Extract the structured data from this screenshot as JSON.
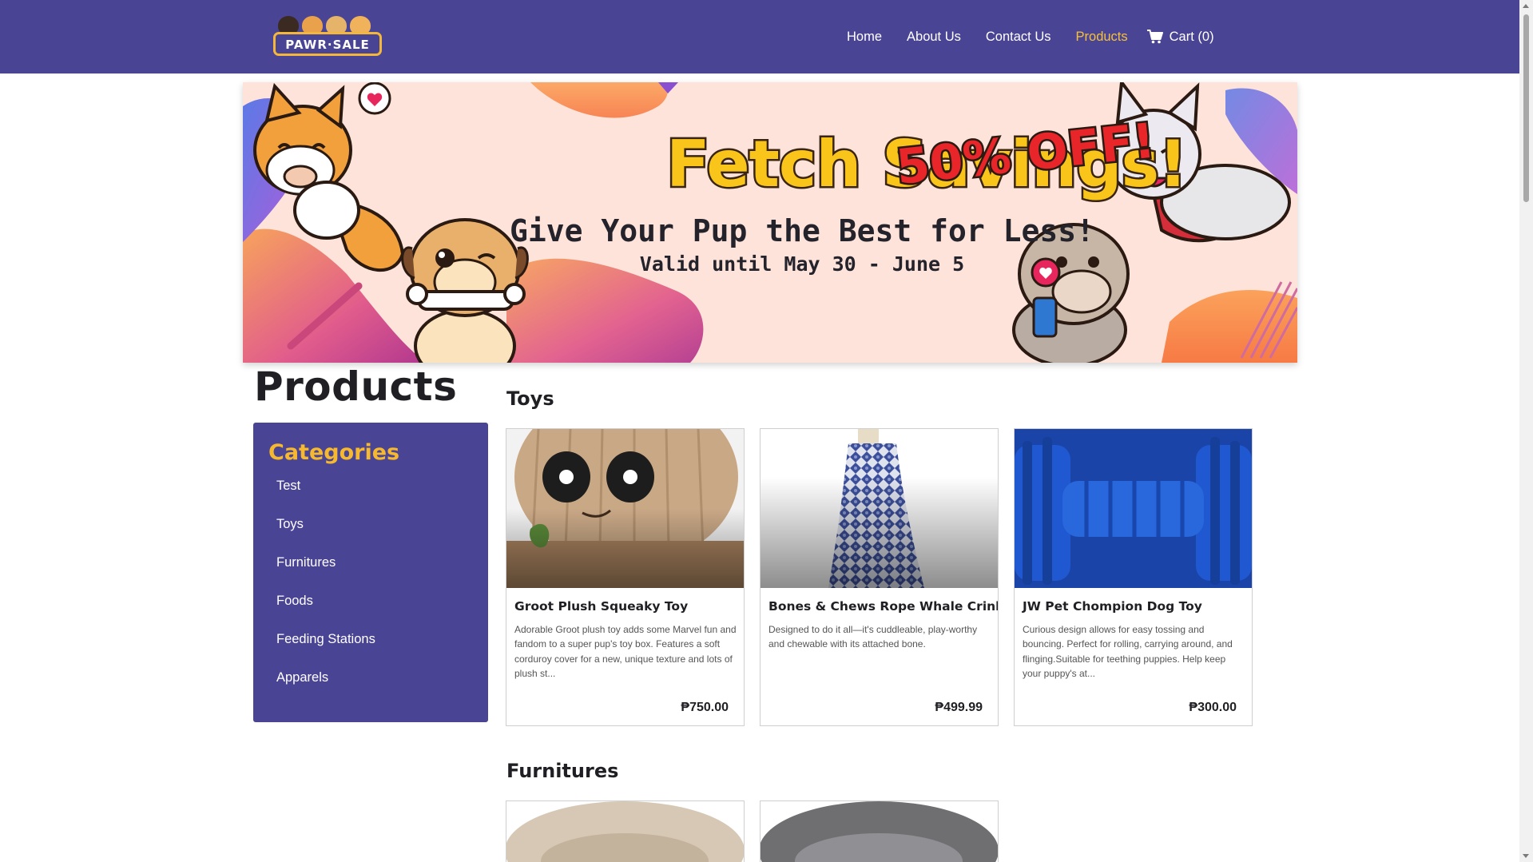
{
  "brand": {
    "logo_text": "PAWR·SALE"
  },
  "nav": {
    "links": [
      "Home",
      "About Us",
      "Contact Us",
      "Products"
    ],
    "cart_label": "Cart (0)"
  },
  "banner": {
    "title": "Fetch Savings!",
    "discount": "50% OFF!",
    "subtitle": "Give Your Pup the Best for Less!",
    "valid": "Valid until May 30 - June 5"
  },
  "page": {
    "title": "Products"
  },
  "sidebar": {
    "title": "Categories",
    "items": [
      "Test",
      "Toys",
      "Furnitures",
      "Foods",
      "Feeding Stations",
      "Apparels"
    ]
  },
  "sections": [
    {
      "title": "Toys",
      "products": [
        {
          "name": "Groot Plush Squeaky Toy",
          "description": "Adorable Groot plush toy adds some Marvel fun and fandom to a super pup's toy box. Features a soft corduroy cover for a new, unique texture and lots of plush st...",
          "price": "₱750.00"
        },
        {
          "name": "Bones & Chews Rope Whale Crinkle",
          "description": "Designed to do it all—it's cuddleable, play-worthy and chewable with its attached bone.",
          "price": "₱499.99"
        },
        {
          "name": "JW Pet Chompion Dog Toy",
          "description": "Curious design allows for easy tossing and bouncing. Perfect for rolling, carrying around, and flinging.Suitable for teething puppies. Help keep your puppy's at...",
          "price": "₱300.00"
        }
      ]
    },
    {
      "title": "Furnitures"
    }
  ],
  "colors": {
    "primary": "#4a4494",
    "accent": "#f5c13c",
    "text": "#1f1f24"
  }
}
